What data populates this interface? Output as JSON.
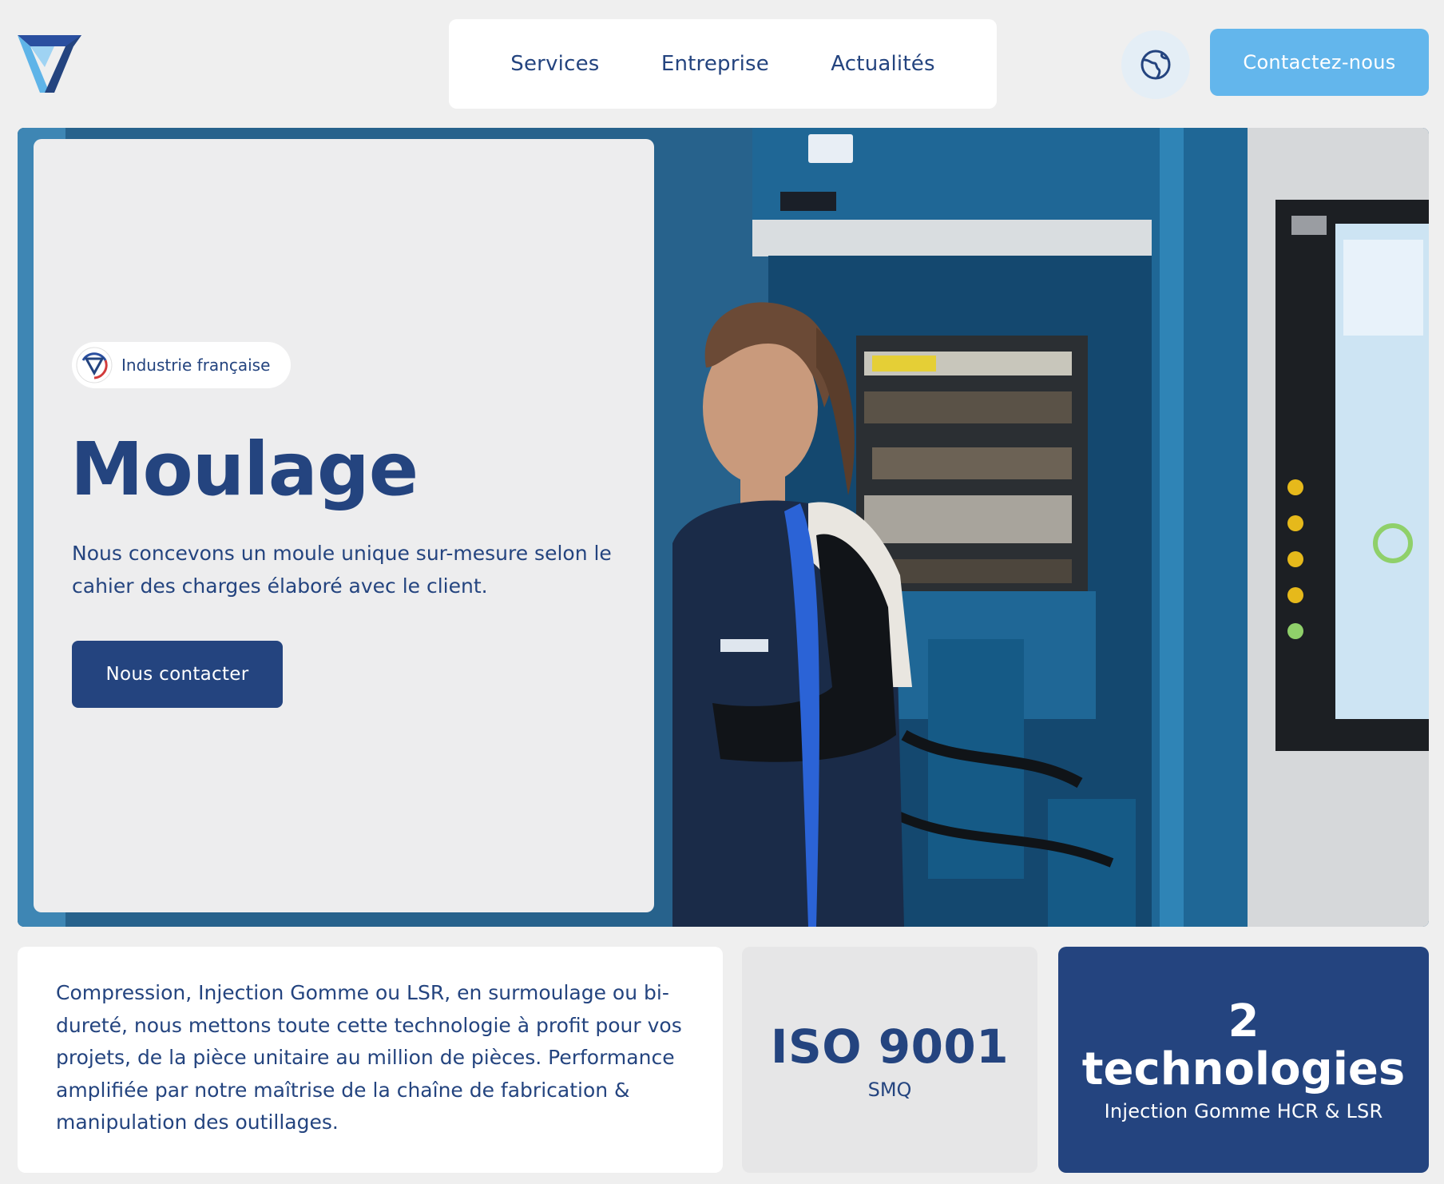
{
  "header": {
    "nav": [
      {
        "label": "Services"
      },
      {
        "label": "Entreprise"
      },
      {
        "label": "Actualités"
      }
    ],
    "contact_label": "Contactez-nous"
  },
  "hero": {
    "badge_label": "Industrie française",
    "title": "Moulage",
    "description": "Nous concevons un moule unique sur-mesure selon le cahier des charges élaboré avec le client.",
    "cta_label": "Nous contacter"
  },
  "features": {
    "text": "Compression, Injection Gomme ou LSR, en surmoulage ou bi-dureté, nous mettons toute cette technologie à profit pour vos projets, de la pièce unitaire au million de pièces. Performance amplifiée par notre maîtrise de la chaîne de fabrication & manipulation des outillages.",
    "iso_value": "ISO 9001",
    "iso_label": "SMQ",
    "tech_count": "2",
    "tech_word": "technologies",
    "tech_label": "Injection Gomme HCR & LSR"
  },
  "colors": {
    "brand_navy": "#24447f",
    "accent_light_blue": "#63b6ec",
    "machine_blue": "#1f5a86",
    "page_bg": "#efefef"
  },
  "icons": {
    "logo": "brand-v-logo",
    "language": "globe-icon"
  }
}
